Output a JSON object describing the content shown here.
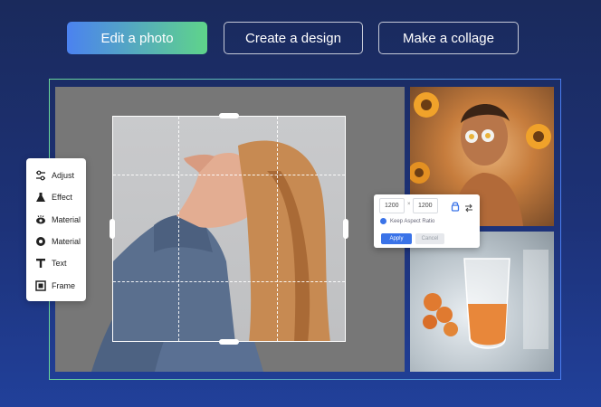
{
  "tabs": [
    {
      "label": "Edit a photo",
      "active": true
    },
    {
      "label": "Create a design",
      "active": false
    },
    {
      "label": "Make a collage",
      "active": false
    }
  ],
  "tools": [
    {
      "label": "Adjust",
      "icon": "sliders-icon"
    },
    {
      "label": "Effect",
      "icon": "flask-icon"
    },
    {
      "label": "Material",
      "icon": "eye-sparkle-icon"
    },
    {
      "label": "Material",
      "icon": "circle-dot-icon"
    },
    {
      "label": "Text",
      "icon": "text-t-icon"
    },
    {
      "label": "Frame",
      "icon": "frame-icon"
    }
  ],
  "resize_panel": {
    "width_value": "1200",
    "separator": "×",
    "height_value": "1200",
    "keep_aspect_label": "Keep Aspect Ratio",
    "apply_label": "Apply",
    "cancel_label": "Cancel"
  },
  "colors": {
    "accent_blue": "#3a73e8",
    "gradient_green": "#5fd48a",
    "background": "#1d3278"
  }
}
